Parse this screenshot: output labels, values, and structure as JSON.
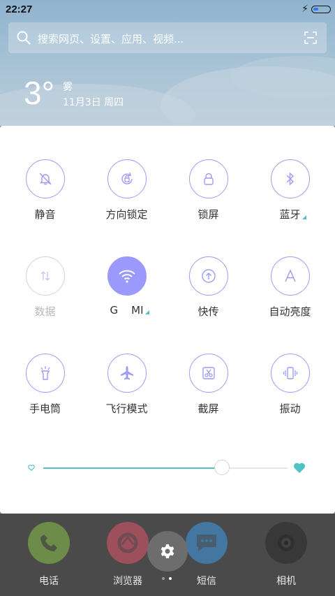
{
  "status_bar": {
    "time": "22:27",
    "battery_fill_fraction": 0.3,
    "icons": [
      "charging-bolt-icon",
      "battery-icon"
    ]
  },
  "search": {
    "placeholder": "搜索网页、设置、应用、视频...",
    "icons": [
      "search-icon",
      "scan-icon"
    ]
  },
  "weather": {
    "temperature": "3°",
    "condition": "雾",
    "date": "11月3日 周四"
  },
  "toggles": [
    {
      "label": "静音",
      "icon": "mute-bell-icon",
      "state": "off"
    },
    {
      "label": "方向锁定",
      "icon": "rotation-lock-icon",
      "state": "off"
    },
    {
      "label": "锁屏",
      "icon": "lock-icon",
      "state": "off"
    },
    {
      "label": "蓝牙",
      "icon": "bluetooth-icon",
      "state": "off",
      "has_more": true
    },
    {
      "label": "数据",
      "icon": "mobile-data-icon",
      "state": "disabled"
    },
    {
      "label": "G    MI",
      "icon": "wifi-icon",
      "state": "on",
      "has_more": true
    },
    {
      "label": "快传",
      "icon": "quick-transfer-icon",
      "state": "off"
    },
    {
      "label": "自动亮度",
      "icon": "auto-brightness-icon",
      "state": "off"
    },
    {
      "label": "手电筒",
      "icon": "flashlight-icon",
      "state": "off"
    },
    {
      "label": "飞行模式",
      "icon": "airplane-icon",
      "state": "off"
    },
    {
      "label": "截屏",
      "icon": "screenshot-icon",
      "state": "off"
    },
    {
      "label": "振动",
      "icon": "vibrate-icon",
      "state": "off"
    }
  ],
  "brightness": {
    "level": 0.73,
    "min_icon": "heart-outline-icon",
    "max_icon": "heart-filled-icon"
  },
  "colors": {
    "accent": "#9b99fb",
    "slider": "#4fc2c3"
  },
  "dock": {
    "apps": [
      {
        "label": "电话",
        "icon": "phone-icon",
        "color": "#8bc34a"
      },
      {
        "label": "浏览器",
        "icon": "browser-icon",
        "color": "#e25569"
      },
      {
        "label": "短信",
        "icon": "message-icon",
        "color": "#3e9be9"
      },
      {
        "label": "相机",
        "icon": "camera-icon",
        "color": "#2b2b2b"
      }
    ],
    "settings_icon": "gear-icon",
    "page_count": 2,
    "current_page": 1
  }
}
